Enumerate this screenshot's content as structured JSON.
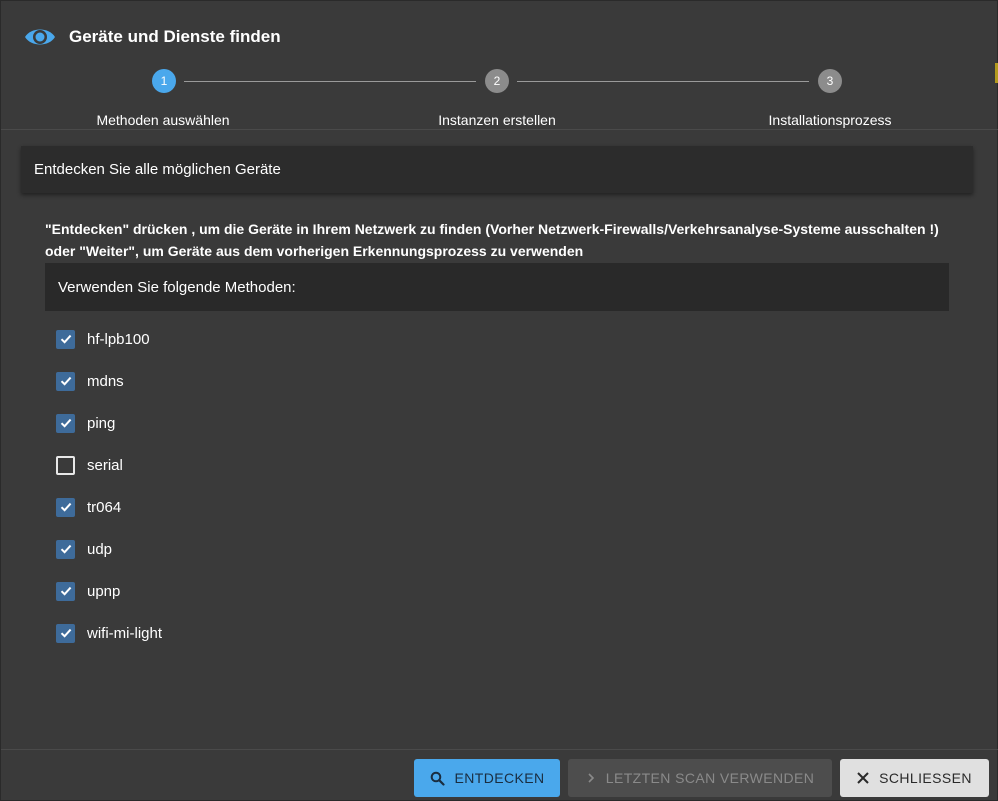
{
  "dialog": {
    "title": "Geräte und Dienste finden",
    "icon": "eye-icon"
  },
  "stepper": {
    "steps": [
      {
        "number": "1",
        "label": "Methoden auswählen",
        "active": true
      },
      {
        "number": "2",
        "label": "Instanzen erstellen",
        "active": false
      },
      {
        "number": "3",
        "label": "Installationsprozess",
        "active": false
      }
    ]
  },
  "content": {
    "section_title": "Entdecken Sie alle möglichen Geräte",
    "instruction": "\"Entdecken\" drücken , um die Geräte in Ihrem Netzwerk zu finden (Vorher Netzwerk-Firewalls/Verkehrsanalyse-Systeme ausschalten !) oder \"Weiter\", um Geräte aus dem vorherigen Erkennungsprozess zu verwenden",
    "methods_header": "Verwenden Sie folgende Methoden:",
    "methods": [
      {
        "label": "hf-lpb100",
        "checked": true
      },
      {
        "label": "mdns",
        "checked": true
      },
      {
        "label": "ping",
        "checked": true
      },
      {
        "label": "serial",
        "checked": false
      },
      {
        "label": "tr064",
        "checked": true
      },
      {
        "label": "udp",
        "checked": true
      },
      {
        "label": "upnp",
        "checked": true
      },
      {
        "label": "wifi-mi-light",
        "checked": true
      }
    ]
  },
  "footer": {
    "discover_label": "ENTDECKEN",
    "last_scan_label": "LETZTEN SCAN VERWENDEN",
    "close_label": "SCHLIESSEN"
  },
  "colors": {
    "accent": "#4aa8ec",
    "checkbox_checked": "#3e6b9a",
    "dialog_background": "#3a3a3a",
    "step_inactive": "#8c8c8c"
  }
}
